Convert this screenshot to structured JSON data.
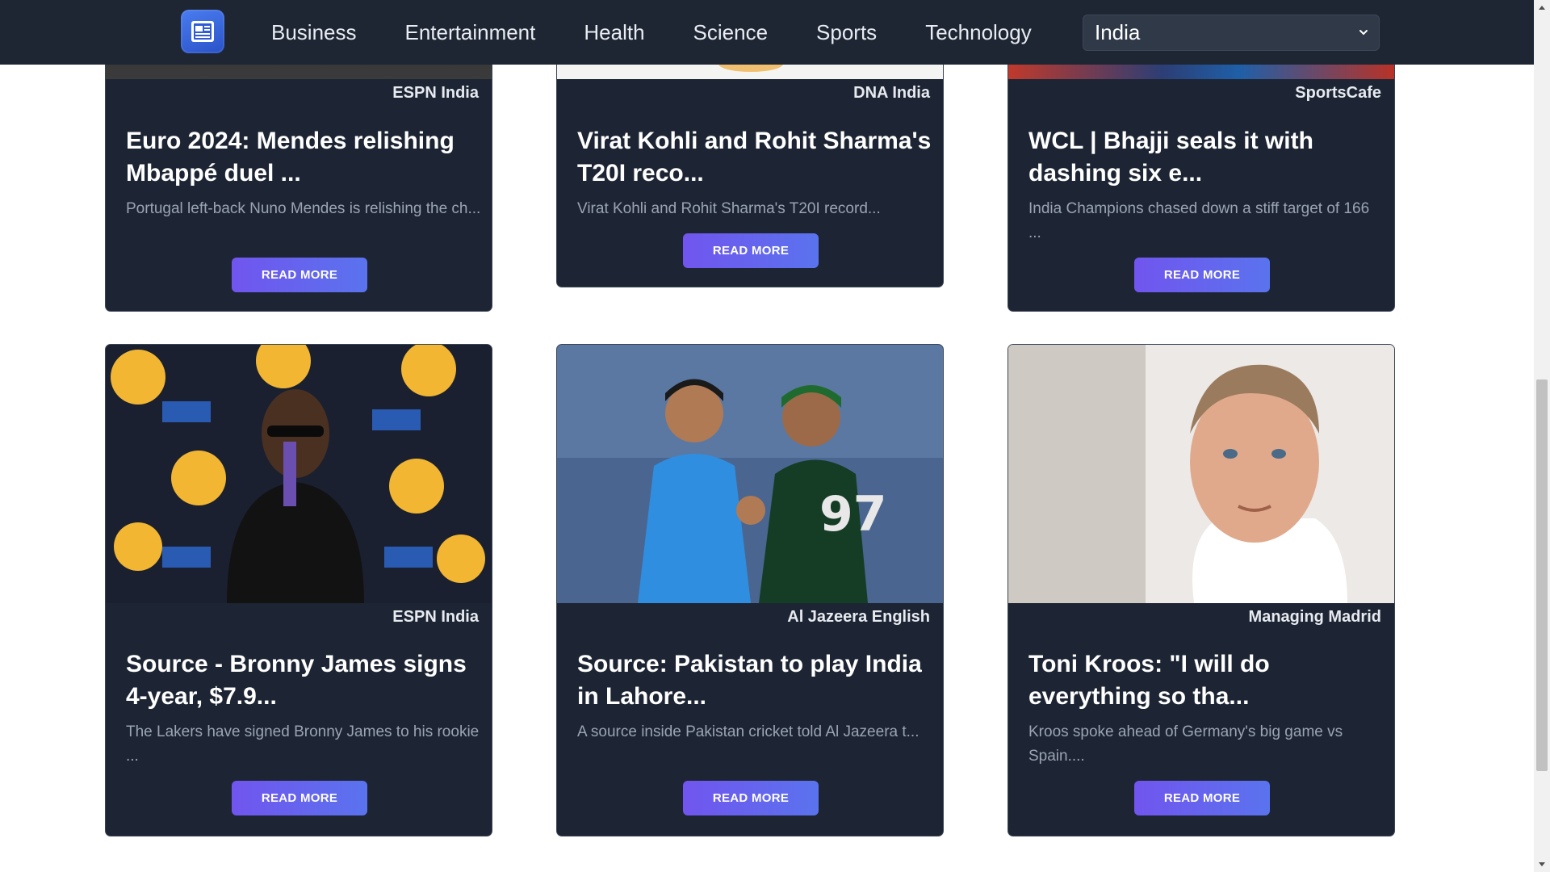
{
  "nav": {
    "links": [
      "Business",
      "Entertainment",
      "Health",
      "Science",
      "Sports",
      "Technology"
    ],
    "country_selected": "India"
  },
  "articles": [
    {
      "source": "ESPN India",
      "title": "Euro 2024: Mendes relishing Mbappé duel ...",
      "description": "Portugal left-back Nuno Mendes is relishing the ch...",
      "button": "READ MORE"
    },
    {
      "source": "DNA India",
      "title": "Virat Kohli and Rohit Sharma's T20I reco...",
      "description": "Virat Kohli and Rohit Sharma's T20I record...",
      "button": "READ MORE"
    },
    {
      "source": "SportsCafe",
      "title": "WCL | Bhajji seals it with dashing six e...",
      "description": "India Champions chased down a stiff target of 166 ...",
      "button": "READ MORE"
    },
    {
      "source": "ESPN India",
      "title": "Source - Bronny James signs 4-year, $7.9...",
      "description": "The Lakers have signed Bronny James to his rookie ...",
      "button": "READ MORE"
    },
    {
      "source": "Al Jazeera English",
      "title": "Source: Pakistan to play India in Lahore...",
      "description": "A source inside Pakistan cricket told Al Jazeera t...",
      "button": "READ MORE"
    },
    {
      "source": "Managing Madrid",
      "title": "Toni Kroos: \"I will do everything so tha...",
      "description": "Kroos spoke ahead of Germany's big game vs Spain....",
      "button": "READ MORE"
    }
  ],
  "colors": {
    "navbar": "#1e2633",
    "card": "#1d2534",
    "button_start": "#7155ee",
    "button_end": "#5a73ee"
  }
}
